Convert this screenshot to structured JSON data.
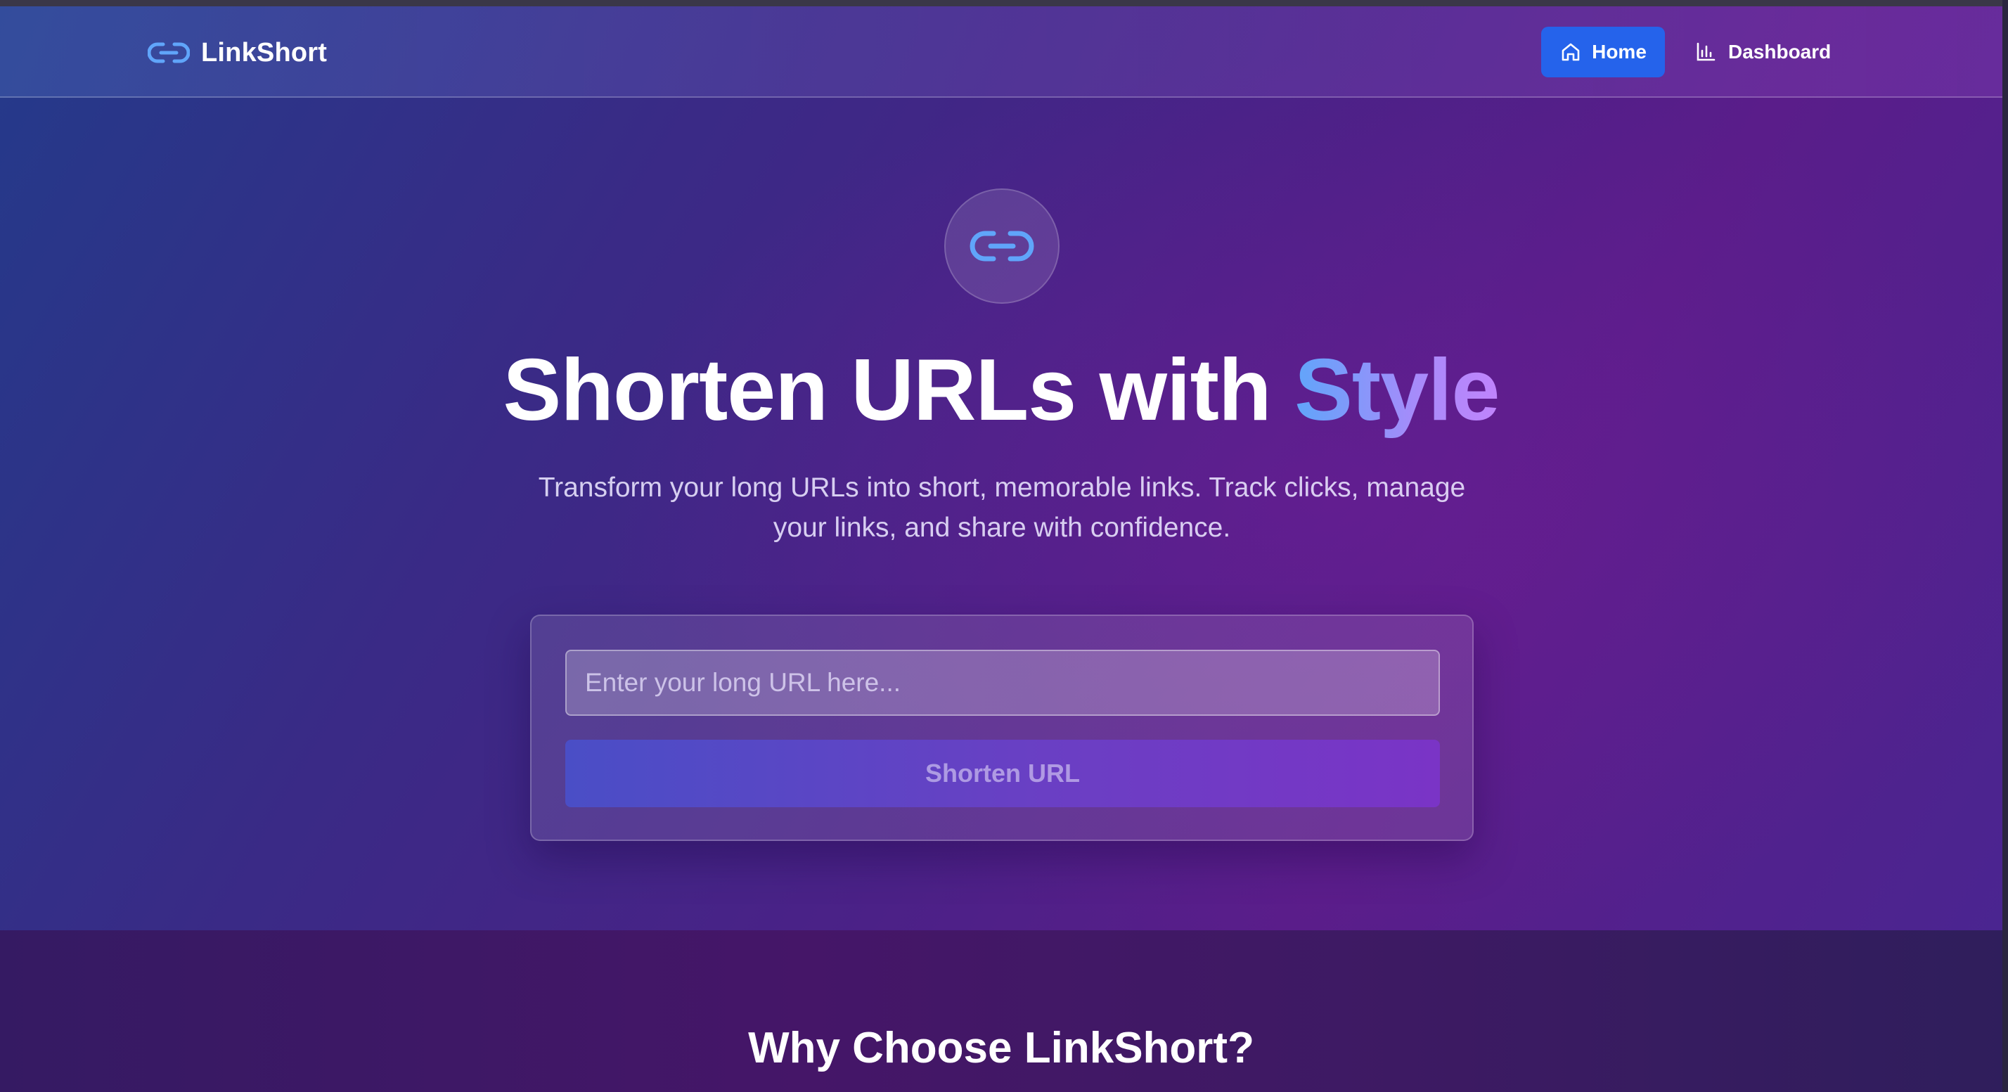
{
  "nav": {
    "brand": "LinkShort",
    "items": [
      {
        "label": "Home",
        "icon": "home-icon",
        "active": true
      },
      {
        "label": "Dashboard",
        "icon": "bar-chart-icon",
        "active": false
      }
    ]
  },
  "hero": {
    "logo_icon": "link-icon",
    "headline_main": "Shorten URLs with ",
    "headline_accent": "Style",
    "subtitle": "Transform your long URLs into short, memorable links. Track clicks, manage your links, and share with confidence.",
    "input_placeholder": "Enter your long URL here...",
    "input_value": "",
    "button_label": "Shorten URL"
  },
  "features": {
    "title": "Why Choose LinkShort?"
  },
  "colors": {
    "accent_blue": "#2563eb",
    "link_icon": "#60a5fa",
    "gradient_start": "#60a5fa",
    "gradient_end": "#c084fc"
  }
}
